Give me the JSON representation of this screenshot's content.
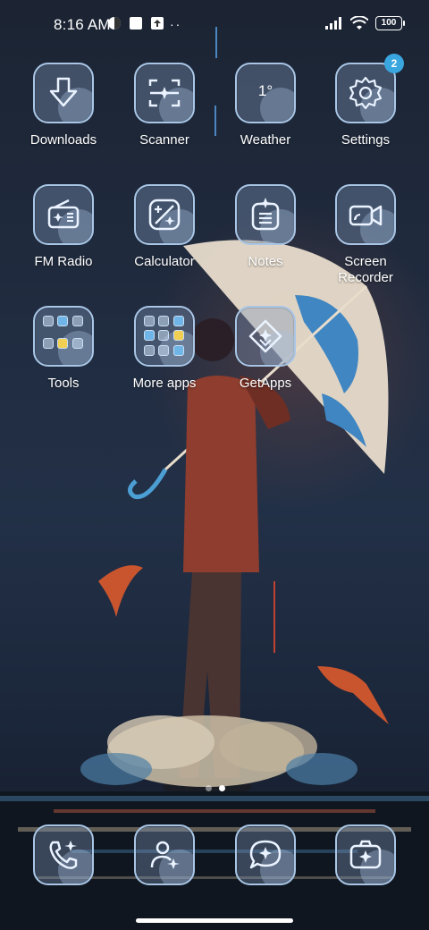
{
  "status_bar": {
    "time": "8:16 AM",
    "left_icons": [
      "vpn-icon",
      "square-icon",
      "upload-icon"
    ],
    "more": "··",
    "right_icons": [
      "signal-icon",
      "wifi-icon"
    ],
    "battery": "100"
  },
  "apps": {
    "downloads": {
      "label": "Downloads",
      "icon": "download-arrow-icon"
    },
    "scanner": {
      "label": "Scanner",
      "icon": "scanner-icon"
    },
    "weather": {
      "label": "Weather",
      "icon_text": "1°"
    },
    "settings": {
      "label": "Settings",
      "icon": "gear-icon",
      "badge": "2"
    },
    "fm_radio": {
      "label": "FM Radio",
      "icon": "radio-icon"
    },
    "calculator": {
      "label": "Calculator",
      "icon": "calculator-icon"
    },
    "notes": {
      "label": "Notes",
      "icon": "notes-icon"
    },
    "screen_recorder": {
      "label": "Screen\nRecorder",
      "icon": "video-camera-icon"
    },
    "tools": {
      "label": "Tools",
      "icon": "folder-icon"
    },
    "more_apps": {
      "label": "More apps",
      "icon": "folder-icon"
    },
    "getapps": {
      "label": "GetApps",
      "icon": "getapps-icon"
    }
  },
  "dock": {
    "phone": {
      "icon": "phone-icon"
    },
    "contacts": {
      "icon": "contacts-icon"
    },
    "messages": {
      "icon": "message-icon"
    },
    "camera": {
      "icon": "camera-icon"
    }
  },
  "pager": {
    "count": 2,
    "active": 2
  },
  "colors": {
    "icon_border": "#a9c6e6",
    "badge": "#3aa6e0",
    "background": "#1f2738"
  }
}
